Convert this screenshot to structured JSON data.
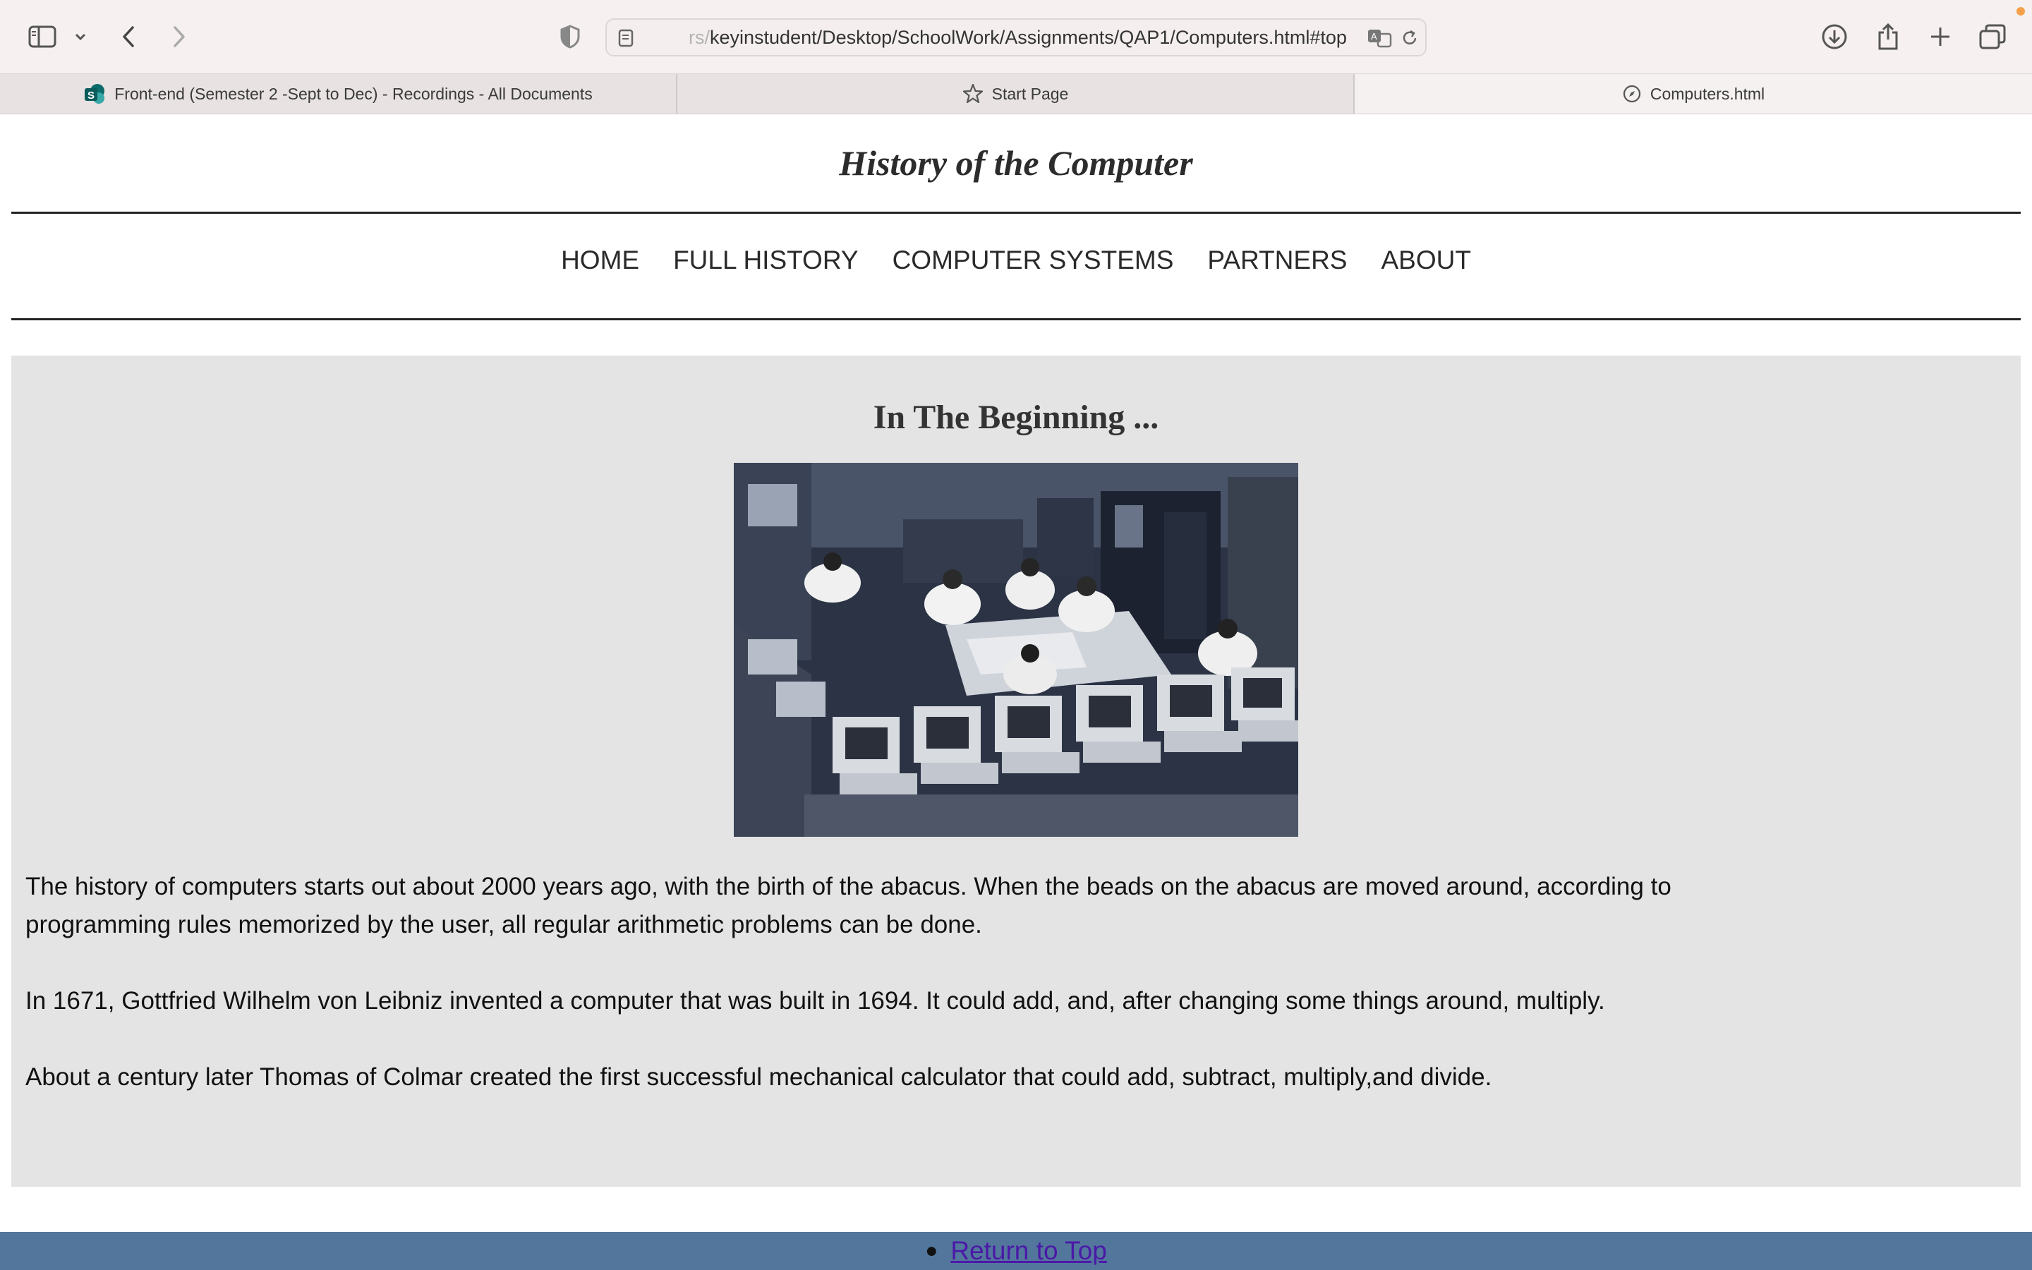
{
  "browser": {
    "address_faded": "rs/",
    "address": "keyinstudent/Desktop/SchoolWork/Assignments/QAP1/Computers.html#top"
  },
  "tabs": [
    {
      "label": "Front-end (Semester 2 -Sept to Dec) - Recordings - All Documents",
      "icon": "sharepoint-icon"
    },
    {
      "label": "Start Page",
      "icon": "star-icon"
    },
    {
      "label": "Computers.html",
      "icon": "compass-icon",
      "active": true
    }
  ],
  "site": {
    "title": "History of the Computer",
    "nav": [
      "HOME",
      "FULL HISTORY",
      "COMPUTER SYSTEMS",
      "PARTNERS",
      "ABOUT"
    ]
  },
  "main": {
    "heading": "In The Beginning ...",
    "paragraphs": [
      "The history of computers starts out about 2000 years ago, with the birth of the abacus. When the beads on the abacus are moved around, according to programming rules memorized by the user, all regular arithmetic problems can be done.",
      "In 1671, Gottfried Wilhelm von Leibniz invented a computer that was built in 1694. It could add, and, after changing some things around, multiply.",
      "About a century later Thomas of Colmar created the first successful mechanical calculator that could add, subtract, multiply,and divide."
    ]
  },
  "footer": {
    "link": "Return to Top"
  },
  "colors": {
    "content_bg": "#e4e4e4",
    "footer_bg": "#53779c",
    "link": "#4b18a8"
  }
}
